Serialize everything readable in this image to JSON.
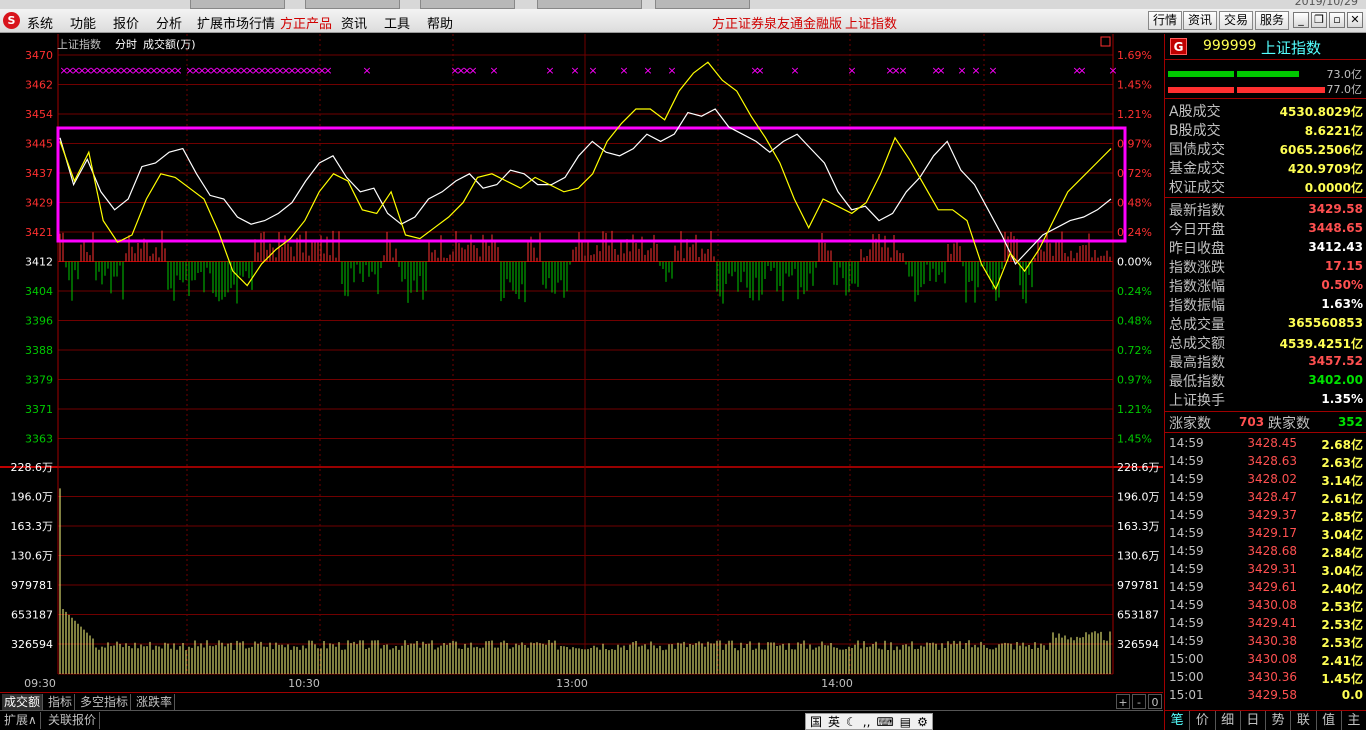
{
  "window": {
    "date_fragment": "2019/10/29"
  },
  "menubar": {
    "items": [
      "系统",
      "功能",
      "报价",
      "分析",
      "扩展市场行情",
      "方正产品",
      "资讯",
      "工具",
      "帮助"
    ],
    "title": "方正证券泉友通金融版",
    "subtitle": "上证指数",
    "right_buttons": [
      "行情",
      "资讯",
      "交易",
      "服务"
    ]
  },
  "chart": {
    "header_title": "上证指数",
    "header_mode": "分时",
    "header_volume": "成交额(万)",
    "price_ticks_left": [
      "3470",
      "3462",
      "3454",
      "3445",
      "3437",
      "3429",
      "3421",
      "3412",
      "3404",
      "3396",
      "3388",
      "3379",
      "3371",
      "3363"
    ],
    "pct_ticks_right": [
      "1.69%",
      "1.45%",
      "1.21%",
      "0.97%",
      "0.72%",
      "0.48%",
      "0.24%",
      "0.00%",
      "0.24%",
      "0.48%",
      "0.72%",
      "0.97%",
      "1.21%",
      "1.45%"
    ],
    "volume_ticks": [
      "228.6万",
      "196.0万",
      "163.3万",
      "130.6万",
      "979781",
      "653187",
      "326594"
    ],
    "time_labels": [
      "09:30",
      "10:30",
      "13:00",
      "14:00"
    ],
    "colors": {
      "up": "#ff3232",
      "down": "#00c800",
      "white_line": "#ffffff",
      "yellow_line": "#ffff00",
      "highlight_box": "#ff00ff",
      "grid": "#8b0000"
    }
  },
  "chart_data": {
    "type": "line",
    "title": "上证指数",
    "x_range": [
      "09:30",
      "15:00"
    ],
    "ylim": [
      3363,
      3470
    ],
    "prev_close": 3412.43,
    "series": [
      {
        "name": "上证指数",
        "values": [
          3447,
          3434,
          3441,
          3432,
          3427,
          3430,
          3439,
          3440,
          3443,
          3444,
          3437,
          3431,
          3430,
          3425,
          3423,
          3424,
          3426,
          3429,
          3435,
          3440,
          3442,
          3436,
          3432,
          3433,
          3426,
          3423,
          3425,
          3430,
          3432,
          3435,
          3437,
          3433,
          3434,
          3438,
          3437,
          3434,
          3434,
          3436,
          3442,
          3446,
          3443,
          3442,
          3444,
          3448,
          3446,
          3448,
          3454,
          3453,
          3455,
          3450,
          3448,
          3446,
          3443,
          3446,
          3448,
          3444,
          3440,
          3432,
          3427,
          3428,
          3424,
          3426,
          3432,
          3436,
          3442,
          3446,
          3438,
          3434,
          3427,
          3420,
          3412,
          3416,
          3420,
          3422,
          3424,
          3425,
          3427,
          3430
        ]
      },
      {
        "name": "均价",
        "values": [
          3446,
          3435,
          3443,
          3424,
          3418,
          3420,
          3430,
          3437,
          3436,
          3433,
          3430,
          3421,
          3410,
          3406,
          3412,
          3416,
          3419,
          3424,
          3432,
          3437,
          3435,
          3427,
          3426,
          3432,
          3420,
          3419,
          3422,
          3425,
          3429,
          3436,
          3437,
          3435,
          3433,
          3436,
          3434,
          3432,
          3433,
          3437,
          3446,
          3451,
          3455,
          3455,
          3452,
          3460,
          3465,
          3468,
          3463,
          3460,
          3453,
          3447,
          3440,
          3430,
          3422,
          3430,
          3428,
          3426,
          3429,
          3437,
          3447,
          3441,
          3434,
          3427,
          3427,
          3424,
          3412,
          3405,
          3415,
          3410,
          3416,
          3424,
          3432,
          3436,
          3440,
          3444
        ]
      }
    ],
    "volume_ylim": [
      0,
      2286000
    ],
    "volume_first": 2050000,
    "volume_typical": 326594,
    "up_down_bars_note": "red above 0%, green below 0%"
  },
  "bottom_tabs": [
    "成交额",
    "指标",
    "多空指标",
    "涨跌率"
  ],
  "bottom_ctrls": [
    "+",
    "-",
    "0"
  ],
  "bottom2_tabs": [
    "扩展∧",
    "关联报价"
  ],
  "ime": [
    "国",
    "英"
  ],
  "panel": {
    "code": "999999",
    "name": "上证指数",
    "bar_top_value": "73.0亿",
    "bar_bottom_value": "77.0亿",
    "rows_a": [
      {
        "k": "A股成交",
        "v": "4530.8029亿",
        "c": "#ffff54"
      },
      {
        "k": "B股成交",
        "v": "8.6221亿",
        "c": "#ffff54"
      },
      {
        "k": "国债成交",
        "v": "6065.2506亿",
        "c": "#ffff54"
      },
      {
        "k": "基金成交",
        "v": "420.9709亿",
        "c": "#ffff54"
      },
      {
        "k": "权证成交",
        "v": "0.0000亿",
        "c": "#ffff54"
      }
    ],
    "rows_b": [
      {
        "k": "最新指数",
        "v": "3429.58",
        "c": "#ff5050"
      },
      {
        "k": "今日开盘",
        "v": "3448.65",
        "c": "#ff5050"
      },
      {
        "k": "昨日收盘",
        "v": "3412.43",
        "c": "#ffffff"
      },
      {
        "k": "指数涨跌",
        "v": "17.15",
        "c": "#ff5050"
      },
      {
        "k": "指数涨幅",
        "v": "0.50%",
        "c": "#ff5050"
      },
      {
        "k": "指数振幅",
        "v": "1.63%",
        "c": "#ffffff"
      },
      {
        "k": "总成交量",
        "v": "365560853",
        "c": "#ffff54"
      },
      {
        "k": "总成交额",
        "v": "4539.4251亿",
        "c": "#ffff54"
      },
      {
        "k": "最高指数",
        "v": "3457.52",
        "c": "#ff5050"
      },
      {
        "k": "最低指数",
        "v": "3402.00",
        "c": "#00e000"
      },
      {
        "k": "上证换手",
        "v": "1.35%",
        "c": "#ffffff"
      }
    ],
    "advance_label": "涨家数",
    "advance_value": "703",
    "decline_label": "跌家数",
    "decline_value": "352",
    "ticks": [
      {
        "t": "14:59",
        "p": "3428.45",
        "a": "2.68亿"
      },
      {
        "t": "14:59",
        "p": "3428.63",
        "a": "2.63亿"
      },
      {
        "t": "14:59",
        "p": "3428.02",
        "a": "3.14亿"
      },
      {
        "t": "14:59",
        "p": "3428.47",
        "a": "2.61亿"
      },
      {
        "t": "14:59",
        "p": "3429.37",
        "a": "2.85亿"
      },
      {
        "t": "14:59",
        "p": "3429.17",
        "a": "3.04亿"
      },
      {
        "t": "14:59",
        "p": "3428.68",
        "a": "2.84亿"
      },
      {
        "t": "14:59",
        "p": "3429.31",
        "a": "3.04亿"
      },
      {
        "t": "14:59",
        "p": "3429.61",
        "a": "2.40亿"
      },
      {
        "t": "14:59",
        "p": "3430.08",
        "a": "2.53亿"
      },
      {
        "t": "14:59",
        "p": "3429.41",
        "a": "2.53亿"
      },
      {
        "t": "14:59",
        "p": "3430.38",
        "a": "2.53亿"
      },
      {
        "t": "15:00",
        "p": "3430.08",
        "a": "2.41亿"
      },
      {
        "t": "15:00",
        "p": "3430.36",
        "a": "1.45亿"
      },
      {
        "t": "15:01",
        "p": "3429.58",
        "a": "0.0"
      }
    ],
    "tabs": [
      "笔",
      "价",
      "细",
      "日",
      "势",
      "联",
      "值",
      "主"
    ]
  }
}
